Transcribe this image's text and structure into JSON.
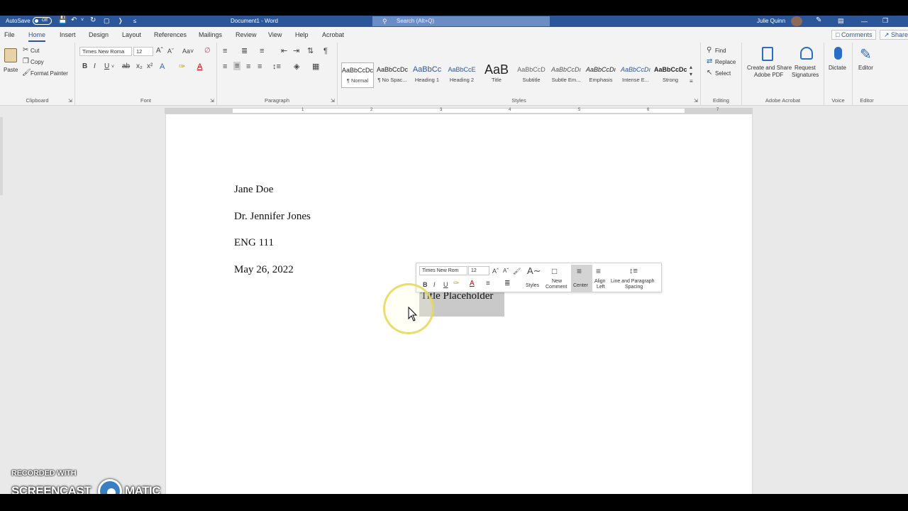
{
  "window": {
    "autosave_label": "AutoSave",
    "autosave_state": "Off",
    "doc_title": "Document1  -  Word",
    "search_placeholder": "Search (Alt+Q)",
    "user_name": "Julie Quinn"
  },
  "tabs": [
    "File",
    "Home",
    "Insert",
    "Design",
    "Layout",
    "References",
    "Mailings",
    "Review",
    "View",
    "Help",
    "Acrobat"
  ],
  "active_tab": "Home",
  "top_buttons": {
    "comments": "Comments",
    "share": "Share"
  },
  "ribbon": {
    "clipboard": {
      "paste": "Paste",
      "cut": "Cut",
      "copy": "Copy",
      "format_painter": "Format Painter",
      "group": "Clipboard"
    },
    "font": {
      "name": "Times New Roma",
      "size": "12",
      "group": "Font"
    },
    "paragraph": {
      "group": "Paragraph"
    },
    "styles": {
      "group": "Styles",
      "items": [
        {
          "sample": "AaBbCcDc",
          "name": "¶ Normal"
        },
        {
          "sample": "AaBbCcDc",
          "name": "¶ No Spac..."
        },
        {
          "sample": "AaBbCc",
          "name": "Heading 1"
        },
        {
          "sample": "AaBbCcE",
          "name": "Heading 2"
        },
        {
          "sample": "AaB",
          "name": "Title"
        },
        {
          "sample": "AaBbCcD",
          "name": "Subtitle"
        },
        {
          "sample": "AaBbCcDı",
          "name": "Subtle Em..."
        },
        {
          "sample": "AaBbCcDı",
          "name": "Emphasis"
        },
        {
          "sample": "AaBbCcDı",
          "name": "Intense E..."
        },
        {
          "sample": "AaBbCcDc",
          "name": "Strong"
        }
      ]
    },
    "editing": {
      "find": "Find",
      "replace": "Replace",
      "select": "Select",
      "group": "Editing"
    },
    "acrobat": {
      "create_share": "Create and Share",
      "create_share2": "Adobe PDF",
      "request": "Request",
      "request2": "Signatures",
      "group": "Adobe Acrobat"
    },
    "voice": {
      "dictate": "Dictate",
      "group": "Voice"
    },
    "editor": {
      "editor": "Editor",
      "group": "Editor"
    }
  },
  "ruler_numbers": [
    "1",
    "2",
    "3",
    "4",
    "5",
    "6",
    "7"
  ],
  "document": {
    "lines": [
      "Jane Doe",
      "Dr. Jennifer Jones",
      "ENG 111",
      "May 26, 2022"
    ],
    "title": "Title Placeholder"
  },
  "mini_toolbar": {
    "font": "Times New Rom",
    "size": "12",
    "styles": "Styles",
    "new_comment1": "New",
    "new_comment2": "Comment",
    "center": "Center",
    "align_left1": "Align",
    "align_left2": "Left",
    "line_spacing1": "Line and Paragraph",
    "line_spacing2": "Spacing"
  },
  "watermark": {
    "line1": "RECORDED WITH",
    "line2a": "SCREENCAST",
    "line2b": "MATIC"
  }
}
